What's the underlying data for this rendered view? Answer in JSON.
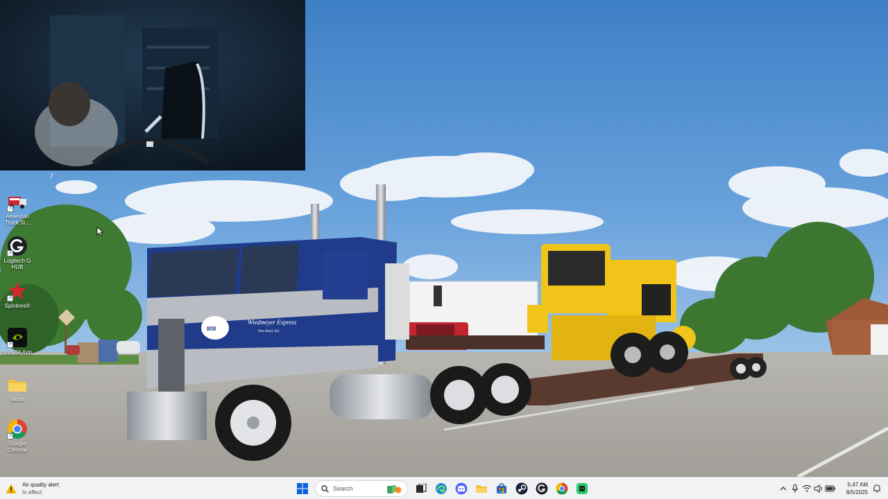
{
  "webcam": {
    "counter": "2"
  },
  "desktop_icons": [
    {
      "label": "American Truck Si...",
      "icon": "american-truck-simulator-icon"
    },
    {
      "label": "Logitech G HUB",
      "icon": "logitech-g-hub-icon"
    },
    {
      "label": "Spintires®",
      "icon": "spintires-icon"
    },
    {
      "label": "NVIDIA App",
      "icon": "nvidia-app-icon"
    },
    {
      "label": "Mods",
      "icon": "folder-icon"
    },
    {
      "label": "Google Chrome",
      "icon": "google-chrome-icon"
    }
  ],
  "wallpaper": {
    "truck_cab_text": "Wiedmeyer Express",
    "truck_cab_subtext": "West Bend, Wis.",
    "truck_emblem": "808"
  },
  "taskbar": {
    "weather": {
      "title": "Air quality alert",
      "subtitle": "In effect",
      "icon": "warning-icon"
    },
    "search_placeholder": "Search",
    "pinned": [
      {
        "name": "file-explorer-button",
        "icon": "folder-icon"
      },
      {
        "name": "edge-button",
        "icon": "edge-icon"
      },
      {
        "name": "discord-button",
        "icon": "discord-icon"
      },
      {
        "name": "explorer-folder-button",
        "icon": "folder-icon"
      },
      {
        "name": "store-button",
        "icon": "store-icon"
      },
      {
        "name": "steam-button",
        "icon": "steam-icon"
      },
      {
        "name": "logitech-button",
        "icon": "logitech-icon"
      },
      {
        "name": "chrome-button",
        "icon": "chrome-icon"
      },
      {
        "name": "app-button",
        "icon": "app-icon"
      }
    ],
    "clock": {
      "time": "5:47 AM",
      "date": "8/5/2025"
    }
  },
  "colors": {
    "sky": "#4a86c8",
    "taskbar": "#f1f2f4",
    "truck_blue": "#1f3b8a",
    "truck_silver": "#b9bcc2",
    "loader_yellow": "#f0c419",
    "accent": "#0a64d8"
  }
}
